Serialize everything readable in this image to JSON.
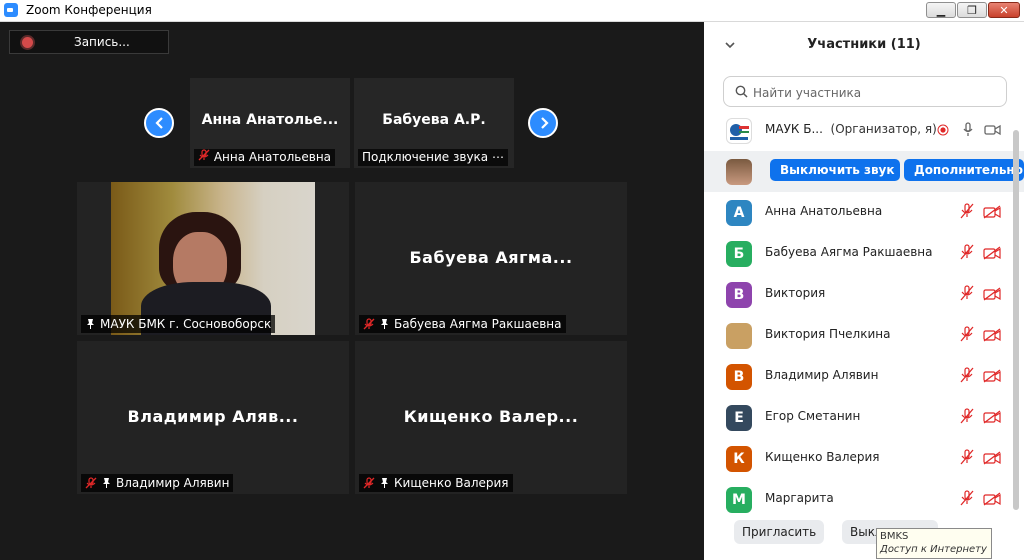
{
  "window": {
    "title": "Zoom Конференция",
    "minimize": "▁",
    "restore": "❐",
    "close": "✕"
  },
  "recording": {
    "label": "Запись..."
  },
  "thumbnails": [
    {
      "display_name": "Анна  Анатолье...",
      "caption": "Анна Анатольевна"
    },
    {
      "display_name": "Бабуева А.Р.",
      "caption": "Подключение звука ⋯"
    }
  ],
  "tiles": [
    {
      "display_name": "",
      "caption": "МАУК БМК г. Сосновоборск"
    },
    {
      "display_name": "Бабуева  Аягма...",
      "caption": "Бабуева Аягма Ракшаевна"
    },
    {
      "display_name": "Владимир  Аляв...",
      "caption": "Владимир Алявин"
    },
    {
      "display_name": "Кищенко  Валер...",
      "caption": "Кищенко Валерия"
    }
  ],
  "panel": {
    "title": "Участники (11)",
    "search_placeholder": "Найти участника",
    "host": {
      "name": "МАУК Б...",
      "role": "(Организатор, я)"
    },
    "selected": {
      "mute_label": "Выключить звук",
      "more_label": "Дополнительно"
    },
    "participants": [
      {
        "initial": "А",
        "name": "Анна Анатольевна",
        "color": "#2e86c1"
      },
      {
        "initial": "Б",
        "name": "Бабуева Аягма Ракшаевна",
        "color": "#27ae60"
      },
      {
        "initial": "В",
        "name": "Виктория",
        "color": "#8e44ad"
      },
      {
        "initial": "",
        "name": "Виктория Пчелкина",
        "color": "#c9a063"
      },
      {
        "initial": "В",
        "name": "Владимир Алявин",
        "color": "#d35400"
      },
      {
        "initial": "Е",
        "name": "Егор Сметанин",
        "color": "#34495e"
      },
      {
        "initial": "К",
        "name": "Кищенко Валерия",
        "color": "#d35400"
      },
      {
        "initial": "М",
        "name": "Маргарита",
        "color": "#27ae60"
      }
    ],
    "footer": {
      "invite": "Пригласить",
      "mute_all": "Выкл"
    }
  },
  "tooltip": {
    "line1": "BMKS",
    "line2": "Доступ к Интернету"
  },
  "colors": {
    "accent": "#0e72ed",
    "muted_red": "#e02828"
  }
}
